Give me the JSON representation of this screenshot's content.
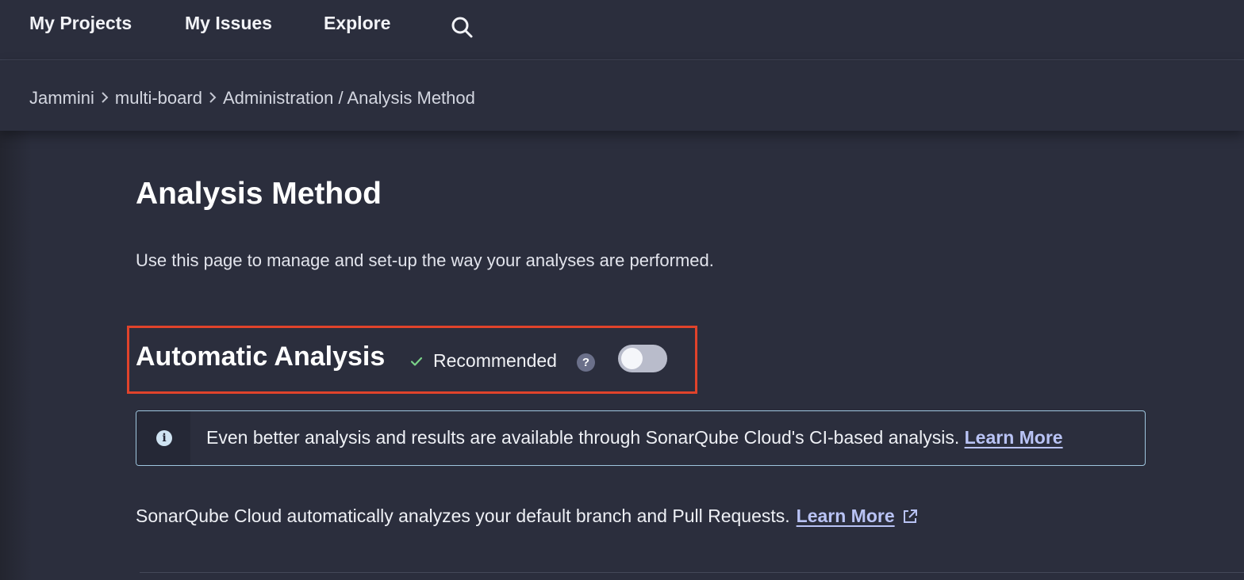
{
  "nav": {
    "items": [
      {
        "label": "My Projects"
      },
      {
        "label": "My Issues"
      },
      {
        "label": "Explore"
      }
    ],
    "search_icon": "search-icon"
  },
  "breadcrumb": {
    "org": "Jammini",
    "project": "multi-board",
    "section": "Administration / Analysis Method"
  },
  "page": {
    "title": "Analysis Method",
    "description": "Use this page to manage and set-up the way your analyses are performed."
  },
  "automatic_analysis": {
    "title": "Automatic Analysis",
    "recommended_label": "Recommended",
    "help_glyph": "?",
    "toggle_enabled": false,
    "info_banner": {
      "text": "Even better analysis and results are available through SonarQube Cloud's CI-based analysis.",
      "link_label": "Learn More"
    },
    "description": "SonarQube Cloud automatically analyzes your default branch and Pull Requests.",
    "description_link_label": "Learn More"
  },
  "colors": {
    "background": "#2b2e3d",
    "highlight_border": "#e0432b",
    "link": "#b9c3f5",
    "check": "#7bd389",
    "info_border": "#9fc6df"
  }
}
